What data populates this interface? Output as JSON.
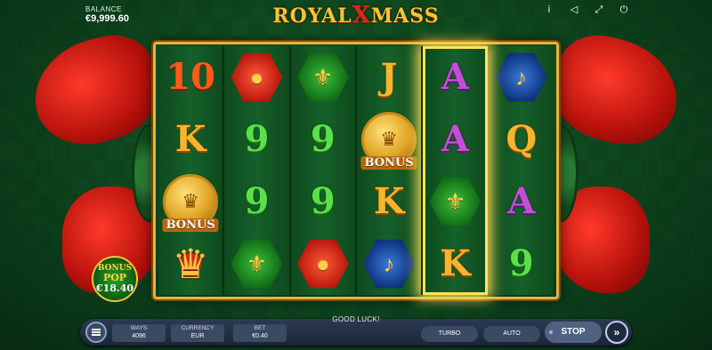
{
  "header": {
    "balance_label": "BALANCE",
    "balance_value": "€9,999.60",
    "logo_part1": "ROYAL",
    "logo_x": "X",
    "logo_part2": "MASS",
    "icons": [
      "info-icon",
      "sound-icon",
      "fullscreen-icon",
      "power-icon"
    ],
    "icon_glyphs": [
      "i",
      "◁",
      "⤢",
      "⏻"
    ]
  },
  "reels": [
    {
      "symbols": [
        "10",
        "K",
        "BONUS",
        "crown"
      ]
    },
    {
      "symbols": [
        "ornament",
        "9",
        "9",
        "scepter"
      ]
    },
    {
      "symbols": [
        "scepter",
        "9",
        "9",
        "ornament"
      ]
    },
    {
      "symbols": [
        "J",
        "BONUS",
        "K",
        "trumpet"
      ]
    },
    {
      "symbols": [
        "A",
        "A",
        "scepter",
        "K"
      ],
      "highlighted": true
    },
    {
      "symbols": [
        "trumpet",
        "Q",
        "A",
        "9"
      ]
    }
  ],
  "bonus_pop": {
    "line1": "BONUS",
    "line2": "POP",
    "amount": "€18.40"
  },
  "message": "GOOD LUCK!",
  "controls": {
    "ways_label": "WAYS",
    "ways_value": "4096",
    "currency_label": "CURRENCY",
    "currency_value": "EUR",
    "bet_label": "BET",
    "bet_value": "€0.40",
    "turbo_label": "TURBO",
    "auto_label": "AUTO",
    "stop_label": "STOP",
    "fast_forward_glyph": "»"
  },
  "colors": {
    "gold": "#f6b52c",
    "green_symbol": "#5be04a",
    "purple_symbol": "#c24fd6",
    "frame": "#e7b43a",
    "highlight": "#ffe25a"
  }
}
